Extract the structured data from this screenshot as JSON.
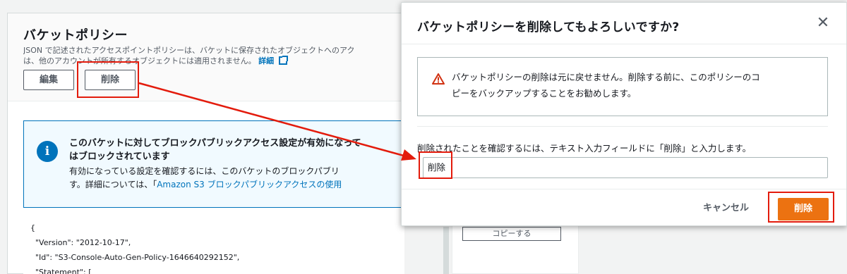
{
  "background": {
    "title": "バケットポリシー",
    "desc_line1": "JSON で記述されたアクセスポイントポリシーは、バケットに保存されたオブジェクトへのアク",
    "desc_line2": "は、他のアカウントが所有するオブジェクトには適用されません。",
    "desc_link": "詳細",
    "edit_label": "編集",
    "delete_label": "削除",
    "info": {
      "title_line1": "このバケットに対してブロックパブリックアクセス設定が有効になって",
      "title_line2": "はブロックされています",
      "body_line1": "有効になっている設定を確認するには、このバケットのブロックパブリ",
      "body_line2_prefix": "す。詳細については、「",
      "body_line2_link": "Amazon S3 ブロックパブリックアクセスの使用"
    },
    "code": {
      "line1": "{",
      "line2": "  \"Version\": \"2012-10-17\",",
      "line3": "  \"Id\": \"S3-Console-Auto-Gen-Policy-1646640292152\",",
      "line4": "  \"Statement\": ["
    },
    "copy_label": "コピーする"
  },
  "modal": {
    "title": "バケットポリシーを削除してもよろしいですか?",
    "close_icon": "close-icon",
    "warning_line1": "バケットポリシーの削除は元に戻せません。削除する前に、このポリシーのコ",
    "warning_line2": "ピーをバックアップすることをお勧めします。",
    "confirm_label": "削除されたことを確認するには、テキスト入力フィールドに「削除」と入力します。",
    "input_value": "削除",
    "cancel_label": "キャンセル",
    "delete_label": "削除"
  },
  "colors": {
    "accent_orange": "#ec7211",
    "highlight_red": "#e31b0c",
    "link_blue": "#0073bb",
    "info_bg": "#f1faff"
  }
}
